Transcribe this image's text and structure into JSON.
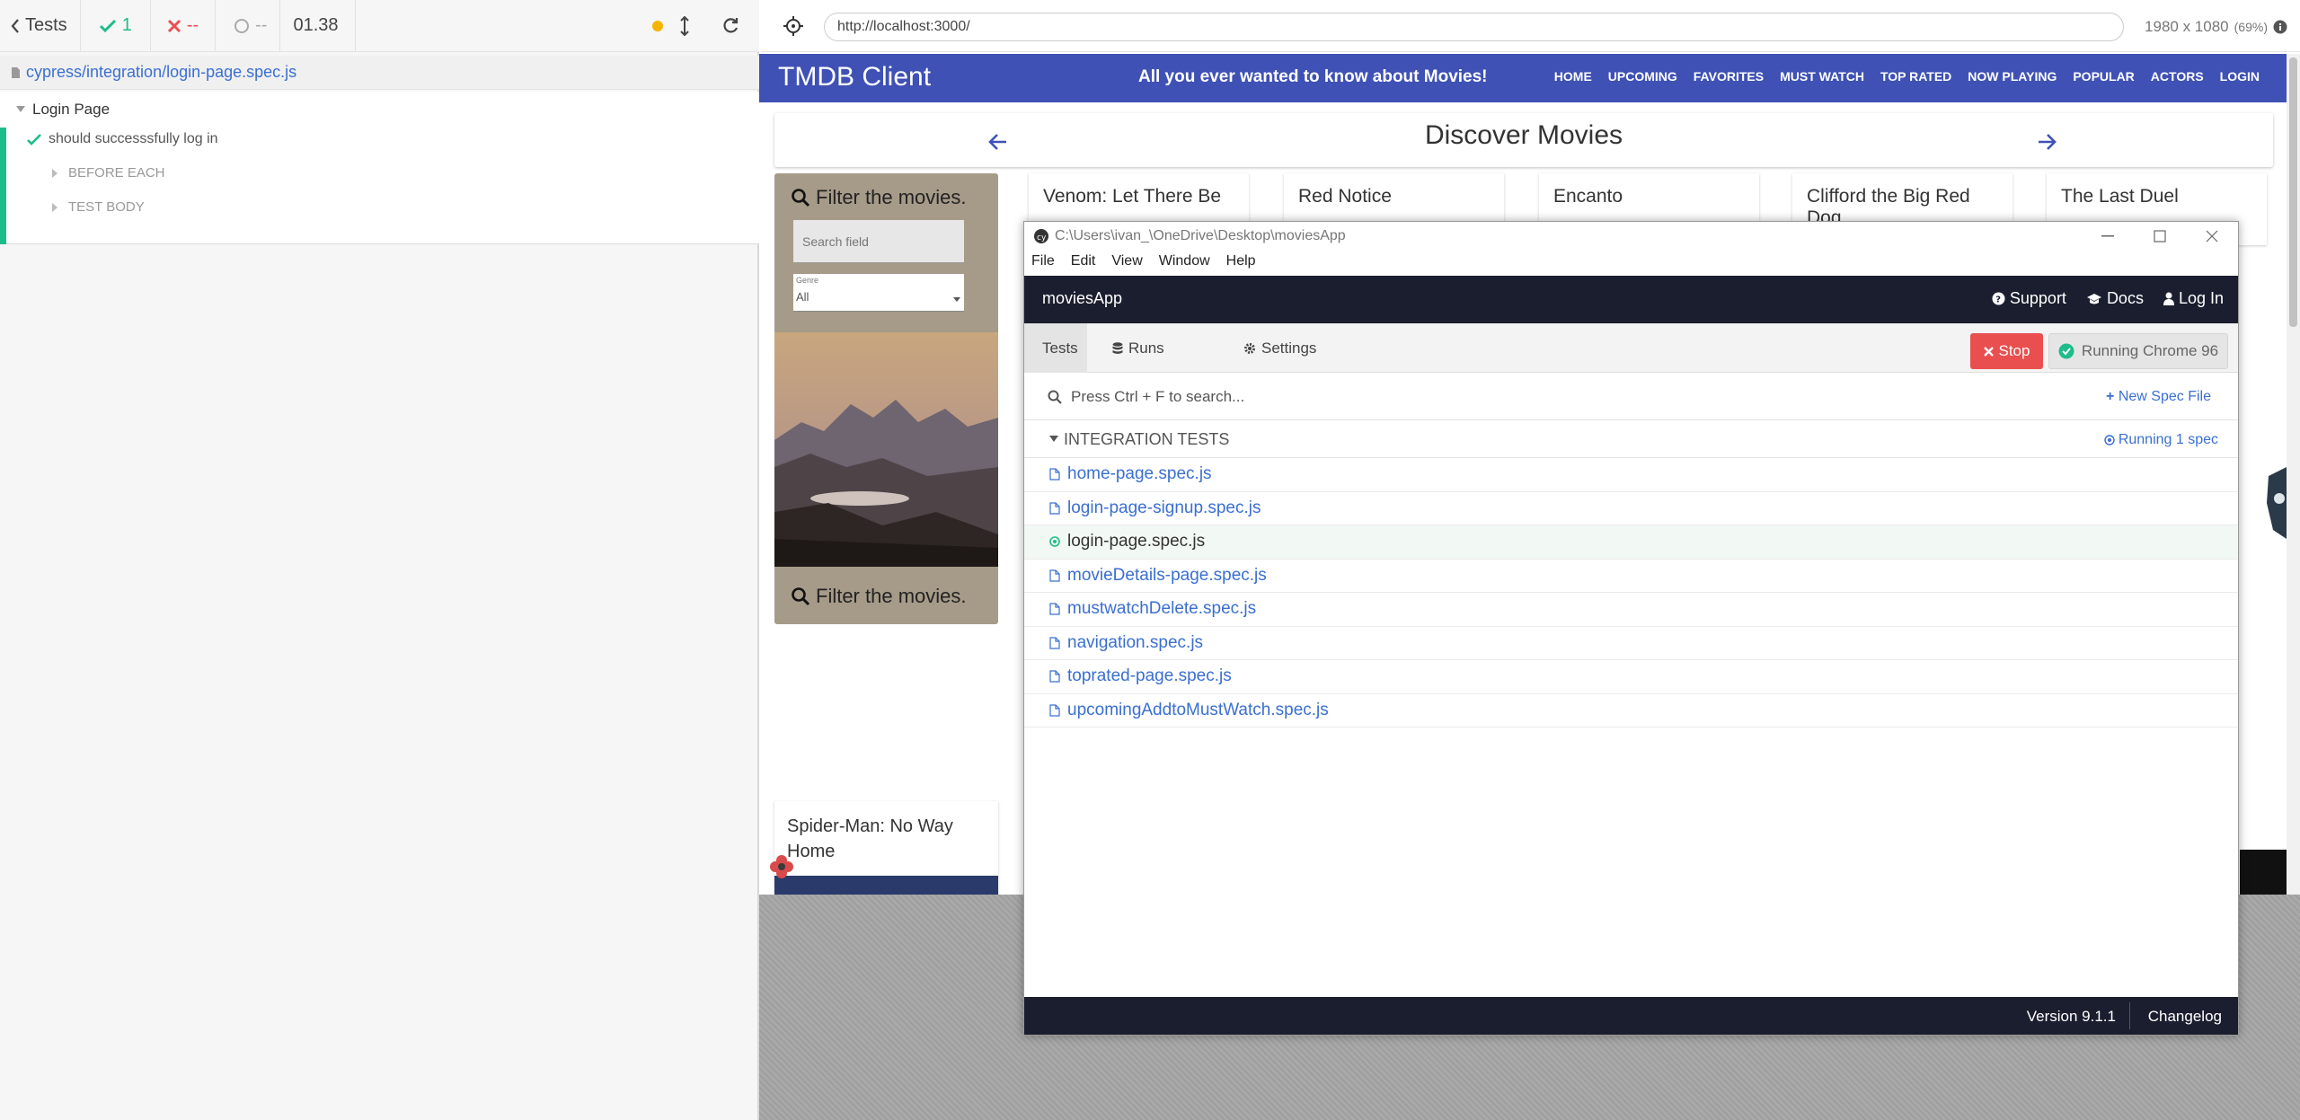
{
  "reporter": {
    "back_label": "Tests",
    "passed": "1",
    "failed": "--",
    "pending": "--",
    "duration": "01.38",
    "spec_path": "cypress/integration/login-page.spec.js",
    "suite": "Login Page",
    "test": "should successsfully log in",
    "hooks": [
      "BEFORE EACH",
      "TEST BODY"
    ]
  },
  "browser": {
    "url": "http://localhost:3000/",
    "viewport": "1980 x 1080",
    "scale": "(69%)"
  },
  "tmdb": {
    "brand": "TMDB Client",
    "tagline": "All you ever wanted to know about Movies!",
    "nav": [
      "HOME",
      "UPCOMING",
      "FAVORITES",
      "MUST WATCH",
      "TOP RATED",
      "NOW PLAYING",
      "POPULAR",
      "ACTORS",
      "LOGIN"
    ],
    "discover_title": "Discover Movies",
    "filter_title": "Filter the movies.",
    "search_placeholder": "Search field",
    "genre_label": "Genre",
    "genre_value": "All",
    "movies": [
      "Venom: Let There Be",
      "Red Notice",
      "Encanto",
      "Clifford the Big Red Dog",
      "The Last Duel"
    ],
    "bottom_movie": "Spider-Man: No Way Home"
  },
  "cypress": {
    "window_title": "C:\\Users\\ivan_\\OneDrive\\Desktop\\moviesApp",
    "menu": [
      "File",
      "Edit",
      "View",
      "Window",
      "Help"
    ],
    "project": "moviesApp",
    "links": {
      "support": "Support",
      "docs": "Docs",
      "login": "Log In"
    },
    "tabs": {
      "tests": "Tests",
      "runs": "Runs",
      "settings": "Settings"
    },
    "stop_label": "Stop",
    "running_label": "Running Chrome 96",
    "search_placeholder": "Press Ctrl + F to search...",
    "new_spec": "New Spec File",
    "integration_label": "INTEGRATION TESTS",
    "running_spec": "Running 1 spec",
    "specs": [
      "home-page.spec.js",
      "login-page-signup.spec.js",
      "login-page.spec.js",
      "movieDetails-page.spec.js",
      "mustwatchDelete.spec.js",
      "navigation.spec.js",
      "toprated-page.spec.js",
      "upcomingAddtoMustWatch.spec.js"
    ],
    "running_index": 2,
    "version": "Version 9.1.1",
    "changelog": "Changelog"
  },
  "colors": {
    "cypress_green": "#1dbd8b",
    "tmdb_indigo": "#3f51b5",
    "link_blue": "#3a6fd1",
    "stop_red": "#e94f4f"
  }
}
